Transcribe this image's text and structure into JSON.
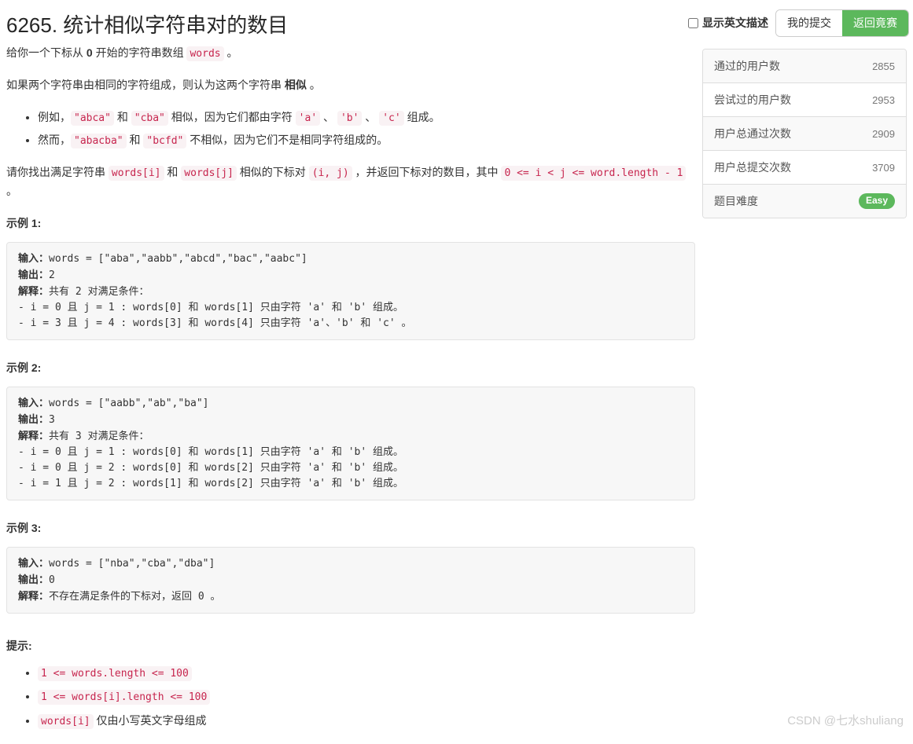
{
  "header": {
    "title": "6265. 统计相似字符串对的数目",
    "show_english_label": "显示英文描述",
    "my_submissions_label": "我的提交",
    "back_to_contest_label": "返回竟赛",
    "accent_color": "#5cb85c"
  },
  "description": {
    "p1_pre": "给你一个下标从 ",
    "p1_bold": "0",
    "p1_mid": " 开始的字符串数组 ",
    "p1_code": "words",
    "p1_post": " 。",
    "p2_pre": "如果两个字符串由相同的字符组成，则认为这两个字符串 ",
    "p2_bold": "相似",
    "p2_post": " 。",
    "bullets": [
      {
        "seg1": "例如，",
        "code1": "\"abca\"",
        "seg2": " 和 ",
        "code2": "\"cba\"",
        "seg3": " 相似，因为它们都由字符 ",
        "code3": "'a'",
        "seg4": " 、 ",
        "code4": "'b'",
        "seg5": " 、 ",
        "code5": "'c'",
        "seg6": " 组成。"
      },
      {
        "seg1": "然而，",
        "code1": "\"abacba\"",
        "seg2": " 和 ",
        "code2": "\"bcfd\"",
        "seg3": " 不相似，因为它们不是相同字符组成的。"
      }
    ],
    "p3_pre": "请你找出满足字符串 ",
    "p3_code1": "words[i]",
    "p3_mid1": " 和 ",
    "p3_code2": "words[j]",
    "p3_mid2": " 相似的下标对 ",
    "p3_code3": "(i, j)",
    "p3_mid3": " ，并返回下标对的数目，其中 ",
    "p3_code4": "0 <= i < j <= word.length - 1",
    "p3_post": " 。"
  },
  "examples": [
    {
      "label": "示例 1:",
      "input_label": "输入：",
      "input_value": "words = [\"aba\",\"aabb\",\"abcd\",\"bac\",\"aabc\"]",
      "output_label": "输出：",
      "output_value": "2",
      "explain_label": "解释：",
      "explain_value": "共有 2 对满足条件：\n- i = 0 且 j = 1 : words[0] 和 words[1] 只由字符 'a' 和 'b' 组成。\n- i = 3 且 j = 4 : words[3] 和 words[4] 只由字符 'a'、'b' 和 'c' 。"
    },
    {
      "label": "示例 2:",
      "input_label": "输入：",
      "input_value": "words = [\"aabb\",\"ab\",\"ba\"]",
      "output_label": "输出：",
      "output_value": "3",
      "explain_label": "解释：",
      "explain_value": "共有 3 对满足条件：\n- i = 0 且 j = 1 : words[0] 和 words[1] 只由字符 'a' 和 'b' 组成。\n- i = 0 且 j = 2 : words[0] 和 words[2] 只由字符 'a' 和 'b' 组成。\n- i = 1 且 j = 2 : words[1] 和 words[2] 只由字符 'a' 和 'b' 组成。"
    },
    {
      "label": "示例 3:",
      "input_label": "输入：",
      "input_value": "words = [\"nba\",\"cba\",\"dba\"]",
      "output_label": "输出：",
      "output_value": "0",
      "explain_label": "解释：",
      "explain_value": "不存在满足条件的下标对，返回 0 。"
    }
  ],
  "hints": {
    "title": "提示:",
    "items": [
      {
        "code": "1 <= words.length <= 100",
        "text": ""
      },
      {
        "code": "1 <= words[i].length <= 100",
        "text": ""
      },
      {
        "code": "words[i]",
        "text": " 仅由小写英文字母组成"
      }
    ]
  },
  "stats": {
    "rows": [
      {
        "label": "通过的用户数",
        "value": "2855"
      },
      {
        "label": "尝试过的用户数",
        "value": "2953"
      },
      {
        "label": "用户总通过次数",
        "value": "2909"
      },
      {
        "label": "用户总提交次数",
        "value": "3709"
      }
    ],
    "difficulty_label": "题目难度",
    "difficulty_value": "Easy"
  },
  "watermark": "CSDN @七水shuliang"
}
